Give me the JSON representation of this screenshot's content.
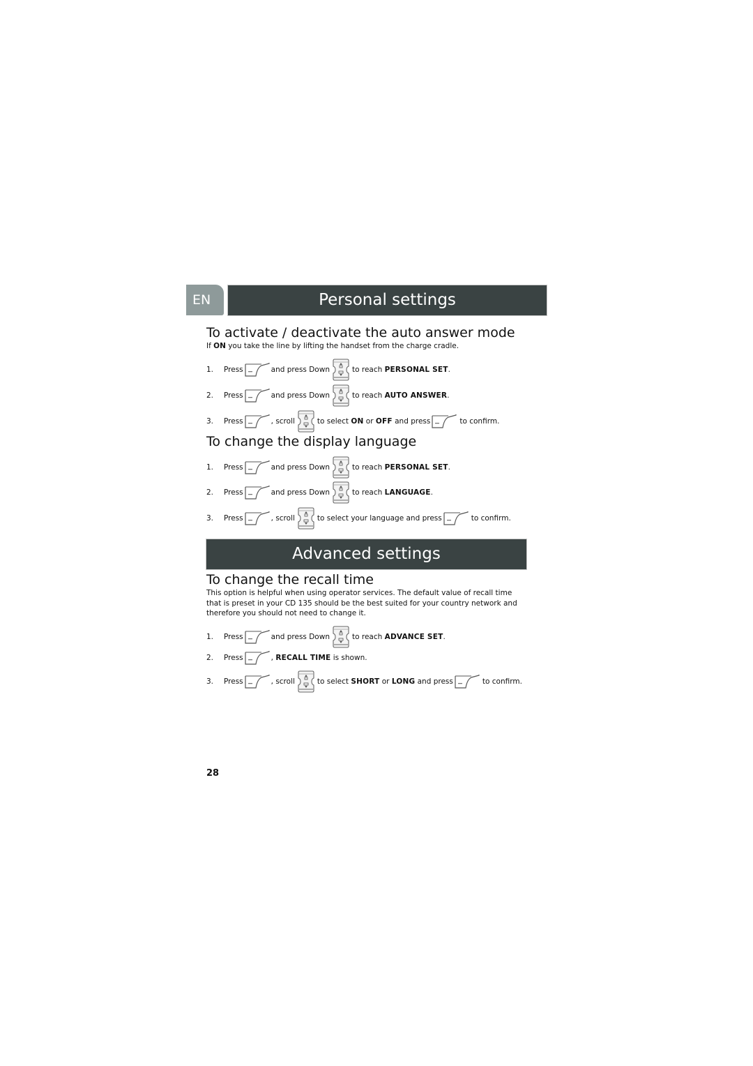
{
  "header": {
    "language_tab": "EN",
    "section_title": "Personal settings"
  },
  "auto_answer": {
    "heading": "To activate / deactivate the auto answer mode",
    "intro_prefix": "If ",
    "intro_bold": "ON",
    "intro_suffix": " you take the line by lifting the handset from the charge cradle.",
    "steps": [
      {
        "num": "1.",
        "press": "Press",
        "mid": "and press Down",
        "reach": "to reach",
        "target": "PERSONAL SET",
        "end": "."
      },
      {
        "num": "2.",
        "press": "Press",
        "mid": "and press Down",
        "reach": "to reach",
        "target": "AUTO ANSWER",
        "end": "."
      },
      {
        "num": "3.",
        "press": "Press",
        "scroll": ", scroll",
        "select": "to select",
        "opt1": "ON",
        "or": "or",
        "opt2": "OFF",
        "and_press": "and press",
        "confirm": "to confirm."
      }
    ]
  },
  "display_language": {
    "heading": "To change the display language",
    "steps": [
      {
        "num": "1.",
        "press": "Press",
        "mid": "and press Down",
        "reach": "to reach",
        "target": "PERSONAL SET",
        "end": "."
      },
      {
        "num": "2.",
        "press": "Press",
        "mid": "and press Down",
        "reach": "to reach",
        "target": "LANGUAGE",
        "end": "."
      },
      {
        "num": "3.",
        "press": "Press",
        "scroll": ", scroll",
        "select": "to select your language and press",
        "confirm": "to confirm."
      }
    ]
  },
  "advanced": {
    "section_title": "Advanced settings"
  },
  "recall_time": {
    "heading": "To change the recall time",
    "paragraph": "This option is helpful when using operator services. The default value of recall time that is preset in your CD 135 should be the best suited for your country network and therefore you should not need to change it.",
    "steps": [
      {
        "num": "1.",
        "press": "Press",
        "mid": "and press Down",
        "reach": "to reach",
        "target": "ADVANCE SET",
        "end": "."
      },
      {
        "num": "2.",
        "press": "Press",
        "comma": ",",
        "target": "RECALL TIME",
        "shown": "is shown."
      },
      {
        "num": "3.",
        "press": "Press",
        "scroll": ", scroll",
        "select": "to select",
        "opt1": "SHORT",
        "or": "or",
        "opt2": "LONG",
        "and_press": "and press",
        "confirm": "to confirm."
      }
    ]
  },
  "icons": {
    "menu_key": "menu-softkey-icon",
    "nav_key": "up-down-navigation-key-icon",
    "menu_key_label": "menu"
  },
  "footer": {
    "page_number": "28"
  },
  "colors": {
    "banner_bg": "#3a4343",
    "lang_tab_bg": "#8e9a9a",
    "text": "#111111"
  }
}
